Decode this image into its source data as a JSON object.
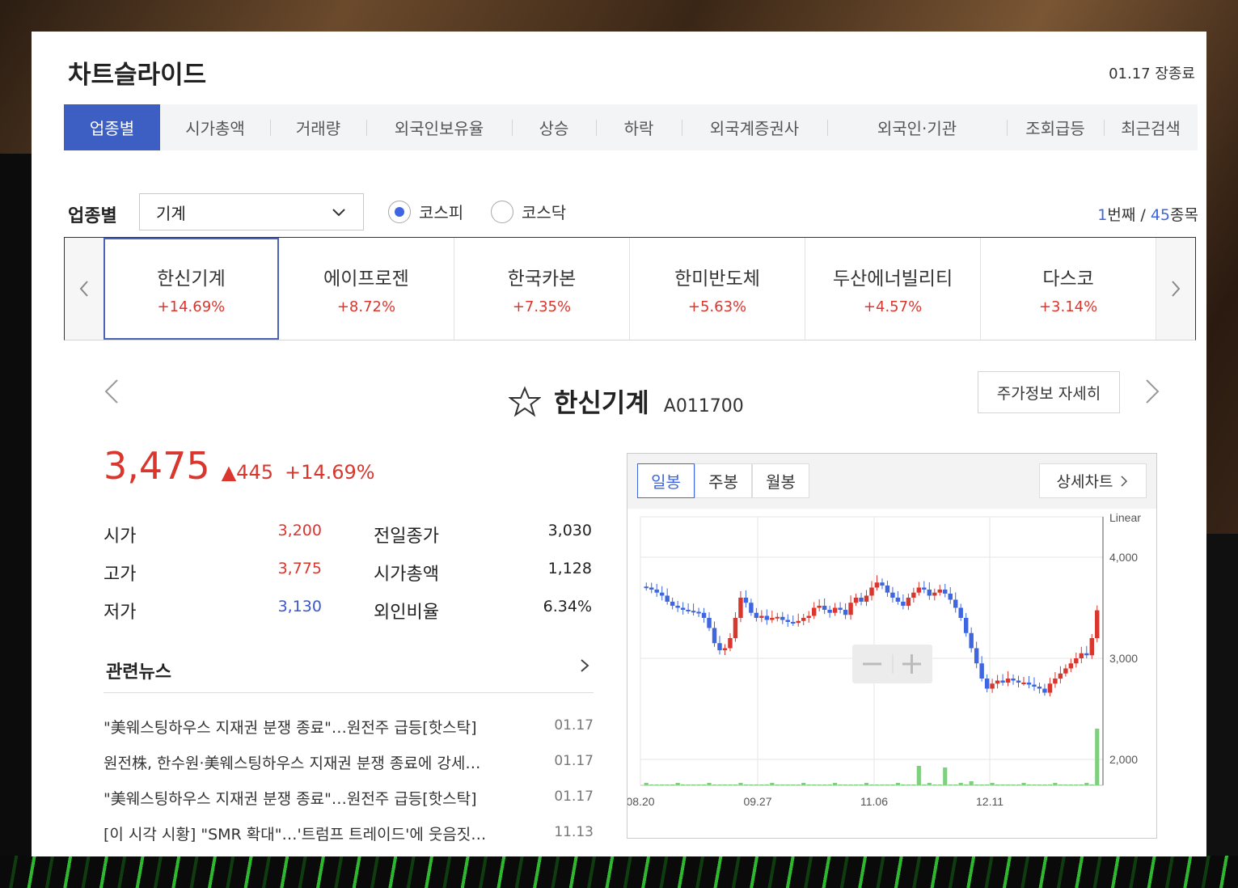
{
  "header": {
    "title": "차트슬라이드",
    "market_status": "01.17 장종료"
  },
  "tabs": [
    {
      "label": "업종별",
      "active": true
    },
    {
      "label": "시가총액"
    },
    {
      "label": "거래량"
    },
    {
      "label": "외국인보유율"
    },
    {
      "label": "상승"
    },
    {
      "label": "하락"
    },
    {
      "label": "외국계증권사"
    },
    {
      "label": "외국인·기관"
    },
    {
      "label": "조회급등"
    },
    {
      "label": "최근검색"
    }
  ],
  "filter": {
    "label": "업종별",
    "selected": "기계",
    "markets": [
      {
        "label": "코스피",
        "checked": true
      },
      {
        "label": "코스닥",
        "checked": false
      }
    ],
    "counter": {
      "current": "1",
      "current_suffix": "번째 / ",
      "total": "45",
      "total_suffix": "종목"
    }
  },
  "strip": [
    {
      "name": "한신기계",
      "rate": "+14.69%",
      "active": true
    },
    {
      "name": "에이프로젠",
      "rate": "+8.72%"
    },
    {
      "name": "한국카본",
      "rate": "+7.35%"
    },
    {
      "name": "한미반도체",
      "rate": "+5.63%"
    },
    {
      "name": "두산에너빌리티",
      "rate": "+4.57%"
    },
    {
      "name": "다스코",
      "rate": "+3.14%"
    }
  ],
  "stock": {
    "name": "한신기계",
    "code": "A011700",
    "detail_button": "주가정보 자세히",
    "price": "3,475",
    "change": "445",
    "change_rate": "+14.69%",
    "stats": {
      "open_label": "시가",
      "open": "3,200",
      "high_label": "고가",
      "high": "3,775",
      "low_label": "저가",
      "low": "3,130",
      "prev_close_label": "전일종가",
      "prev_close": "3,030",
      "market_cap_label": "시가총액",
      "market_cap": "1,128",
      "foreign_ratio_label": "외인비율",
      "foreign_ratio": "6.34%"
    }
  },
  "news": {
    "title": "관련뉴스",
    "items": [
      {
        "text": "\"美웨스팅하우스 지재권 분쟁 종료\"…원전주 급등[핫스탁]",
        "date": "01.17"
      },
      {
        "text": "원전株, 한수원·美웨스팅하우스 지재권 분쟁 종료에 강세…",
        "date": "01.17"
      },
      {
        "text": "\"美웨스팅하우스 지재권 분쟁 종료\"…원전주 급등[핫스탁]",
        "date": "01.17"
      },
      {
        "text": "[이 시각 시황] \"SMR 확대\"…'트럼프 트레이드'에 웃음짓…",
        "date": "11.13"
      }
    ]
  },
  "chart_panel": {
    "periods": [
      {
        "label": "일봉",
        "active": true
      },
      {
        "label": "주봉"
      },
      {
        "label": "월봉"
      }
    ],
    "detail_button": "상세차트"
  },
  "colors": {
    "up": "#d9362e",
    "down": "#3d66e0",
    "accent": "#3d5fc4",
    "volume": "#7ed07e"
  },
  "chart_data": {
    "type": "candlestick",
    "scale_label": "Linear",
    "x_ticks": [
      "08.20",
      "09.27",
      "11.06",
      "12.11"
    ],
    "y_ticks": [
      4000,
      3000,
      2000
    ],
    "ylim": [
      2000,
      4400
    ],
    "close_series": [
      3700,
      3680,
      3650,
      3620,
      3560,
      3520,
      3500,
      3480,
      3470,
      3460,
      3450,
      3400,
      3300,
      3150,
      3080,
      3100,
      3200,
      3400,
      3600,
      3550,
      3450,
      3400,
      3420,
      3380,
      3400,
      3410,
      3380,
      3360,
      3350,
      3370,
      3400,
      3420,
      3500,
      3520,
      3480,
      3450,
      3500,
      3480,
      3430,
      3550,
      3600,
      3560,
      3620,
      3700,
      3750,
      3720,
      3650,
      3600,
      3560,
      3520,
      3600,
      3650,
      3700,
      3680,
      3620,
      3650,
      3680,
      3640,
      3580,
      3500,
      3400,
      3250,
      3100,
      2950,
      2800,
      2700,
      2750,
      2780,
      2760,
      2800,
      2780,
      2760,
      2760,
      2740,
      2720,
      2700,
      2660,
      2750,
      2800,
      2850,
      2900,
      2950,
      3000,
      3050,
      3030,
      3200,
      3475
    ]
  }
}
